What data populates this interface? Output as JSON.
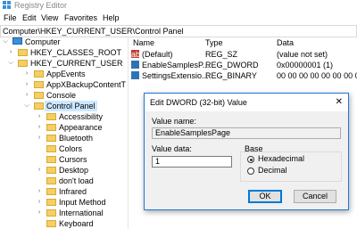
{
  "window": {
    "title": "Registry Editor"
  },
  "menu": [
    "File",
    "Edit",
    "View",
    "Favorites",
    "Help"
  ],
  "address": "Computer\\HKEY_CURRENT_USER\\Control Panel",
  "tree": [
    {
      "label": "Computer",
      "arrow": "⌵",
      "kind": "computer"
    },
    {
      "label": "HKEY_CLASSES_ROOT",
      "arrow": "›",
      "kind": "folder"
    },
    {
      "label": "HKEY_CURRENT_USER",
      "arrow": "⌵",
      "kind": "folder"
    },
    {
      "label": "AppEvents",
      "arrow": "›",
      "kind": "folder"
    },
    {
      "label": "AppXBackupContentT",
      "arrow": "›",
      "kind": "folder"
    },
    {
      "label": "Console",
      "arrow": "›",
      "kind": "folder"
    },
    {
      "label": "Control Panel",
      "arrow": "⌵",
      "kind": "folder",
      "selected": true
    },
    {
      "label": "Accessibility",
      "arrow": "›",
      "kind": "folder"
    },
    {
      "label": "Appearance",
      "arrow": "›",
      "kind": "folder"
    },
    {
      "label": "Bluetooth",
      "arrow": "›",
      "kind": "folder"
    },
    {
      "label": "Colors",
      "arrow": "",
      "kind": "folder"
    },
    {
      "label": "Cursors",
      "arrow": "",
      "kind": "folder"
    },
    {
      "label": "Desktop",
      "arrow": "›",
      "kind": "folder"
    },
    {
      "label": "don't load",
      "arrow": "",
      "kind": "folder"
    },
    {
      "label": "Infrared",
      "arrow": "›",
      "kind": "folder"
    },
    {
      "label": "Input Method",
      "arrow": "›",
      "kind": "folder"
    },
    {
      "label": "International",
      "arrow": "›",
      "kind": "folder"
    },
    {
      "label": "Keyboard",
      "arrow": "",
      "kind": "folder"
    }
  ],
  "list": {
    "headers": {
      "name": "Name",
      "type": "Type",
      "data": "Data"
    },
    "rows": [
      {
        "icon": "ab",
        "name": "(Default)",
        "type": "REG_SZ",
        "data": "(value not set)"
      },
      {
        "icon": "bin",
        "name": "EnableSamplesP...",
        "type": "REG_DWORD",
        "data": "0x00000001 (1)"
      },
      {
        "icon": "bin",
        "name": "SettingsExtensio...",
        "type": "REG_BINARY",
        "data": "00 00 00 00 00 00 00 00"
      }
    ]
  },
  "dialog": {
    "title": "Edit DWORD (32-bit) Value",
    "close": "✕",
    "value_name_label": "Value name:",
    "value_name": "EnableSamplesPage",
    "value_data_label": "Value data:",
    "value_data": "1",
    "base_label": "Base",
    "base_options": [
      {
        "label": "Hexadecimal",
        "checked": true
      },
      {
        "label": "Decimal",
        "checked": false
      }
    ],
    "ok": "OK",
    "cancel": "Cancel"
  }
}
